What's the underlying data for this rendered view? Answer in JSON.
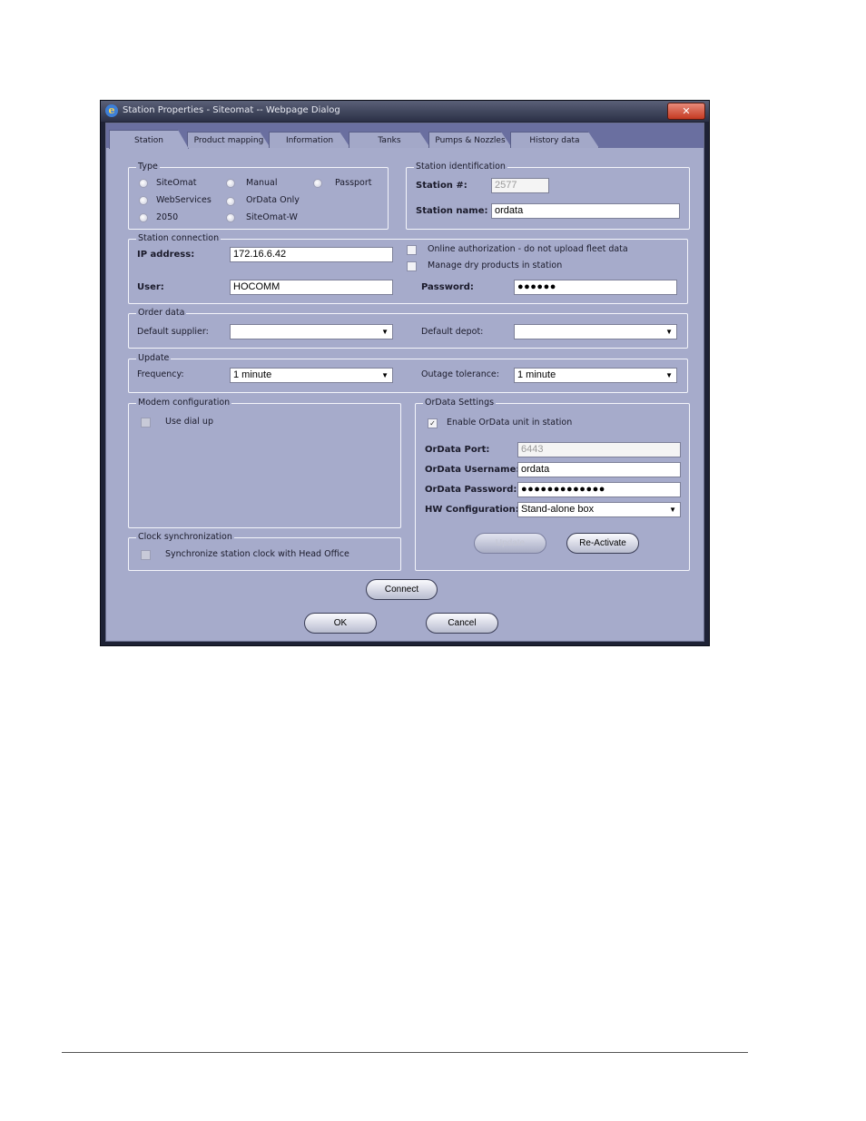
{
  "window": {
    "title": "Station Properties - Siteomat -- Webpage Dialog",
    "close_glyph": "✕"
  },
  "tabs": [
    {
      "label": "Station",
      "active": true
    },
    {
      "label": "Product mapping",
      "active": false
    },
    {
      "label": "Information",
      "active": false
    },
    {
      "label": "Tanks",
      "active": false
    },
    {
      "label": "Pumps & Nozzles",
      "active": false
    },
    {
      "label": "History data",
      "active": false
    }
  ],
  "type_group": {
    "legend": "Type",
    "options": [
      "SiteOmat",
      "Manual",
      "Passport",
      "WebServices",
      "OrData Only",
      "2050",
      "SiteOmat-W"
    ]
  },
  "station_identification": {
    "legend": "Station identification",
    "station_number_label": "Station #:",
    "station_number_value": "2577",
    "station_name_label": "Station name:",
    "station_name_value": "ordata"
  },
  "station_connection": {
    "legend": "Station connection",
    "ip_label": "IP address:",
    "ip_value": "172.16.6.42",
    "online_auth_label": "Online authorization - do not upload fleet data",
    "dry_products_label": "Manage dry products in station",
    "user_label": "User:",
    "user_value": "HOCOMM",
    "password_label": "Password:",
    "password_value": "●●●●●●"
  },
  "order_data": {
    "legend": "Order data",
    "supplier_label": "Default supplier:",
    "supplier_value": "",
    "depot_label": "Default depot:",
    "depot_value": ""
  },
  "update": {
    "legend": "Update",
    "frequency_label": "Frequency:",
    "frequency_value": "1 minute",
    "outage_label": "Outage tolerance:",
    "outage_value": "1 minute"
  },
  "modem": {
    "legend": "Modem configuration",
    "dial_up_label": "Use dial up"
  },
  "clock": {
    "legend": "Clock synchronization",
    "sync_label": "Synchronize station clock with Head Office"
  },
  "ordata_settings": {
    "legend": "OrData Settings",
    "enable_label": "Enable OrData unit in station",
    "enable_checked": "✓",
    "port_label": "OrData Port:",
    "port_value": "6443",
    "username_label": "OrData Username:",
    "username_value": "ordata",
    "password_label": "OrData Password:",
    "password_value": "●●●●●●●●●●●●●",
    "hw_label": "HW Configuration:",
    "hw_value": "Stand-alone box",
    "update_button": "Update",
    "reactivate_button": "Re-Activate"
  },
  "buttons": {
    "connect": "Connect",
    "ok": "OK",
    "cancel": "Cancel"
  },
  "icons": {
    "dropdown_arrow": "▼",
    "app_icon_glyph": "e"
  }
}
